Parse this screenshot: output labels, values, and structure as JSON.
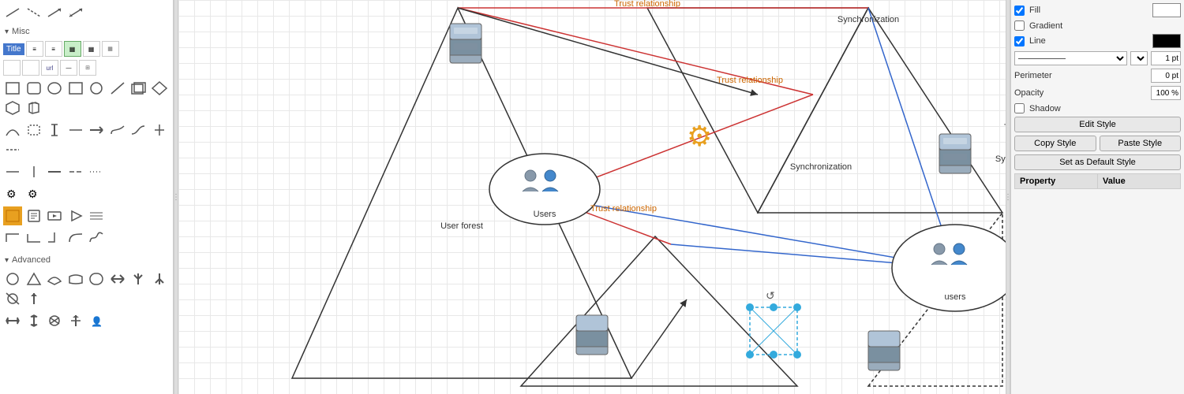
{
  "leftPanel": {
    "sections": [
      {
        "name": "Misc",
        "label": "Misc"
      },
      {
        "name": "Advanced",
        "label": "Advanced"
      }
    ],
    "titleRowItems": [
      "Title",
      "≡",
      "≡",
      "▦",
      "▦",
      "▦"
    ],
    "shapeRows": [
      [
        "rect",
        "rrect",
        "ellipse",
        "rect2",
        "circle"
      ],
      [
        "line",
        "rect3",
        "diamond",
        "hexagon",
        "3d"
      ],
      [
        "arc",
        "bracket",
        "pipe",
        "dash",
        "more"
      ],
      [
        "hdash",
        "vline",
        "hline",
        "dash2",
        "dash3"
      ],
      [
        "gear1",
        "gear2"
      ]
    ]
  },
  "rightPanel": {
    "fill": {
      "label": "Fill",
      "checked": true
    },
    "gradient": {
      "label": "Gradient",
      "checked": false
    },
    "line": {
      "label": "Line",
      "checked": true,
      "color": "black",
      "width": "1 pt"
    },
    "perimeter": {
      "label": "Perimeter",
      "value": "0 pt"
    },
    "opacity": {
      "label": "Opacity",
      "value": "100 %"
    },
    "shadow": {
      "label": "Shadow",
      "checked": false
    },
    "buttons": {
      "editStyle": "Edit Style",
      "copyStyle": "Copy Style",
      "pasteStyle": "Paste Style",
      "setDefault": "Set as Default Style"
    },
    "propertyTable": {
      "col1": "Property",
      "col2": "Value"
    }
  },
  "canvas": {
    "labels": {
      "trustRel1": "Trust relationship",
      "trustRel2": "Trust relationship",
      "trustRel3": "Trust relationship",
      "sync1": "Synchronization",
      "sync2": "Synchronization",
      "sync3": "Synchronization",
      "users1": "Users",
      "users2": "users",
      "userForest": "User forest"
    }
  }
}
